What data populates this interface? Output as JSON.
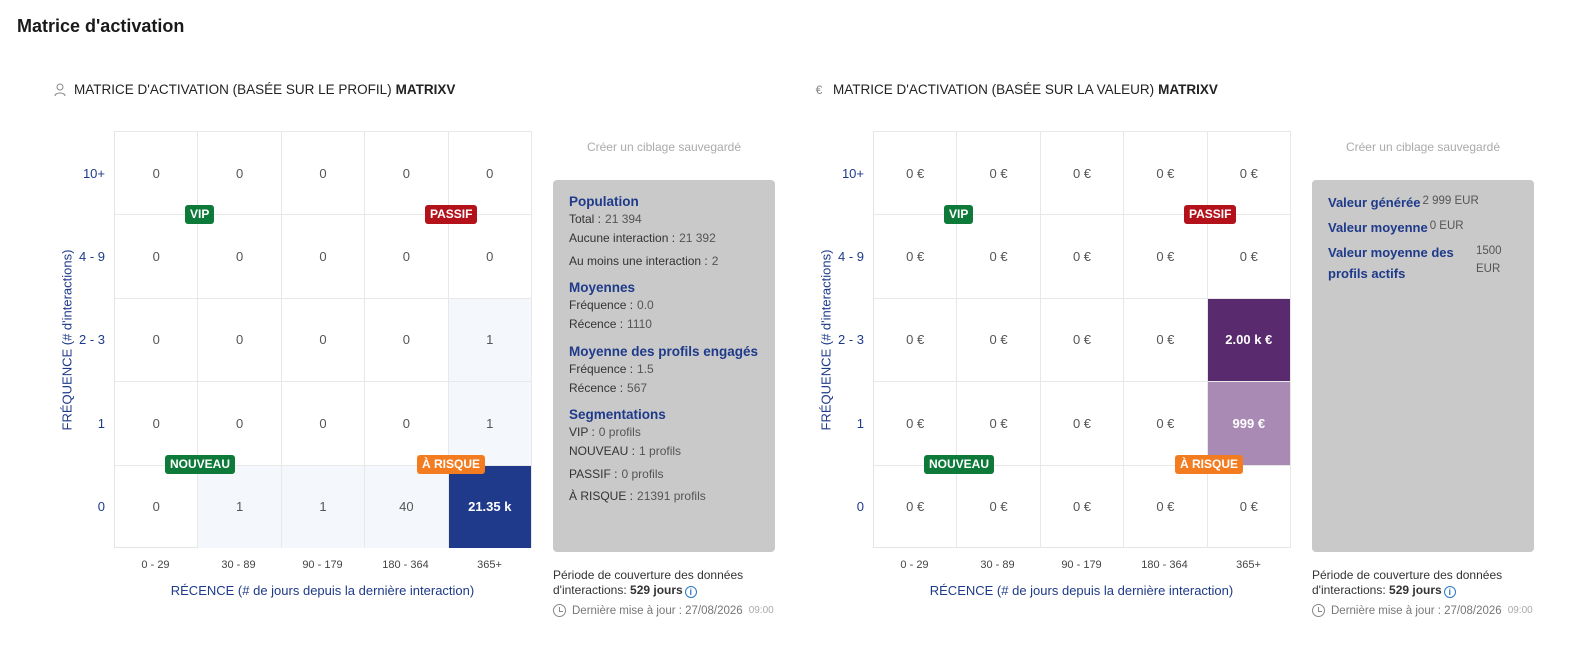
{
  "page_title": "Matrice d'activation",
  "profile_panel": {
    "heading_prefix": "MATRICE D'ACTIVATION (BASÉE SUR LE PROFIL)",
    "heading_name": "MATRIXV",
    "icon": "person-icon",
    "y_axis_label": "FRÉQUENCE (# d'interactions)",
    "x_axis_label": "RÉCENCE (# de jours depuis la dernière interaction)",
    "y_ticks": [
      "10+",
      "4 - 9",
      "2 - 3",
      "1",
      "0"
    ],
    "x_ticks": [
      "0 - 29",
      "30 - 89",
      "90 - 179",
      "180 - 364",
      "365+"
    ],
    "rows": [
      [
        "0",
        "0",
        "0",
        "0",
        "0"
      ],
      [
        "0",
        "0",
        "0",
        "0",
        "0"
      ],
      [
        "0",
        "0",
        "0",
        "0",
        "1"
      ],
      [
        "0",
        "0",
        "0",
        "0",
        "1"
      ],
      [
        "0",
        "1",
        "1",
        "40",
        "21.35 k"
      ]
    ],
    "badges": {
      "vip": "VIP",
      "passif": "PASSIF",
      "nouveau": "NOUVEAU",
      "risque": "À RISQUE"
    },
    "save_link": "Créer un ciblage sauvegardé",
    "population": {
      "title": "Population",
      "total_label": "Total :",
      "total_value": "21 394",
      "no_interaction_label": "Aucune interaction :",
      "no_interaction_value": "21 392",
      "one_interaction_label": "Au moins une interaction :",
      "one_interaction_value": "2"
    },
    "averages": {
      "title": "Moyennes",
      "frequency_label": "Fréquence :",
      "frequency_value": "0.0",
      "recency_label": "Récence :",
      "recency_value": "1110"
    },
    "engaged_averages": {
      "title": "Moyenne des profils engagés",
      "frequency_label": "Fréquence :",
      "frequency_value": "1.5",
      "recency_label": "Récence :",
      "recency_value": "567"
    },
    "segmentations": {
      "title": "Segmentations",
      "vip_label": "VIP :",
      "vip_value": "0 profils",
      "nouveau_label": "NOUVEAU :",
      "nouveau_value": "1 profils",
      "passif_label": "PASSIF :",
      "passif_value": "0 profils",
      "risque_label": "À RISQUE :",
      "risque_value": "21391 profils"
    },
    "coverage_text": "Période de couverture des données d'interactions:",
    "coverage_value": "529 jours",
    "updated_label": "Dernière mise à jour : 27/08/2026",
    "updated_time": "09:00"
  },
  "value_panel": {
    "heading_prefix": "MATRICE D'ACTIVATION (BASÉE SUR LA VALEUR)",
    "heading_name": "MATRIXV",
    "icon": "euro-icon",
    "y_axis_label": "FRÉQUENCE (# d'interactions)",
    "x_axis_label": "RÉCENCE (# de jours depuis la dernière interaction)",
    "y_ticks": [
      "10+",
      "4 - 9",
      "2 - 3",
      "1",
      "0"
    ],
    "x_ticks": [
      "0 - 29",
      "30 - 89",
      "90 - 179",
      "180 - 364",
      "365+"
    ],
    "rows": [
      [
        "0 €",
        "0 €",
        "0 €",
        "0 €",
        "0 €"
      ],
      [
        "0 €",
        "0 €",
        "0 €",
        "0 €",
        "0 €"
      ],
      [
        "0 €",
        "0 €",
        "0 €",
        "0 €",
        "2.00 k €"
      ],
      [
        "0 €",
        "0 €",
        "0 €",
        "0 €",
        "999 €"
      ],
      [
        "0 €",
        "0 €",
        "0 €",
        "0 €",
        "0 €"
      ]
    ],
    "badges": {
      "vip": "VIP",
      "passif": "PASSIF",
      "nouveau": "NOUVEAU",
      "risque": "À RISQUE"
    },
    "save_link": "Créer un ciblage sauvegardé",
    "values": {
      "generated_label": "Valeur générée",
      "generated_value": "2 999 EUR",
      "average_label": "Valeur moyenne",
      "average_value": "0 EUR",
      "active_label": "Valeur moyenne des profils actifs",
      "active_value": "1500 EUR"
    },
    "coverage_text": "Période de couverture des données d'interactions:",
    "coverage_value": "529 jours",
    "updated_label": "Dernière mise à jour : 27/08/2026",
    "updated_time": "09:00"
  },
  "colors": {
    "dark_blue": "#1f3a8a",
    "light_blue": "#f4f7fc",
    "violet": "#5a2a6e",
    "lilac": "#a98ab4",
    "green_badge": "#0e7a3a",
    "red_badge": "#b3121a",
    "orange_badge": "#f47c20",
    "info_box": "#c9c9c9"
  }
}
